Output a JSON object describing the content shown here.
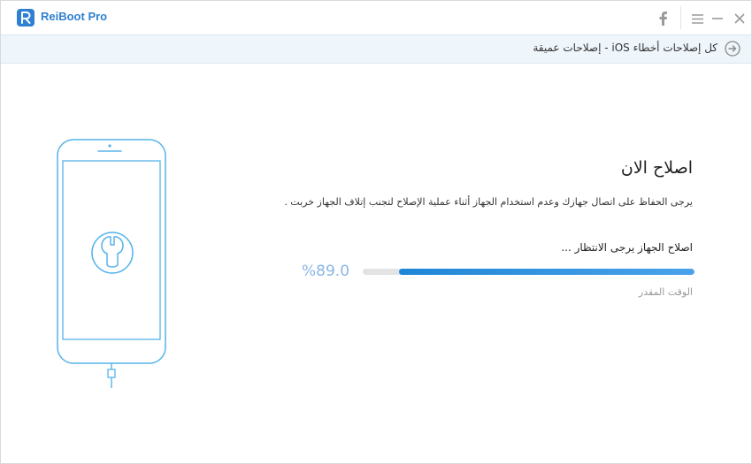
{
  "app": {
    "title": "ReiBoot Pro"
  },
  "titlebar": {
    "facebook_icon": "facebook-icon",
    "menu_icon": "menu-icon",
    "minimize_icon": "minimize-icon",
    "close_icon": "close-icon"
  },
  "breadcrumb": {
    "text": "كل إصلاحات أخطاء iOS - إصلاحات عميقة",
    "back_icon": "arrow-circle-icon"
  },
  "main": {
    "heading": "اصلاح الان",
    "description": "يرجى الحفاظ على اتصال جهازك وعدم استخدام الجهاز أثناء عملية الإصلاح لتجنب إتلاف الجهاز خربت .",
    "status": "اصلاح الجهاز يرجى الانتظار ...",
    "percent_text": "%89.0",
    "progress": 0.89,
    "remaining_label": "الوقت المقدر"
  },
  "colors": {
    "accent": "#2f80d1",
    "progress": "#1f86d6",
    "phone_outline": "#56b3ea"
  }
}
